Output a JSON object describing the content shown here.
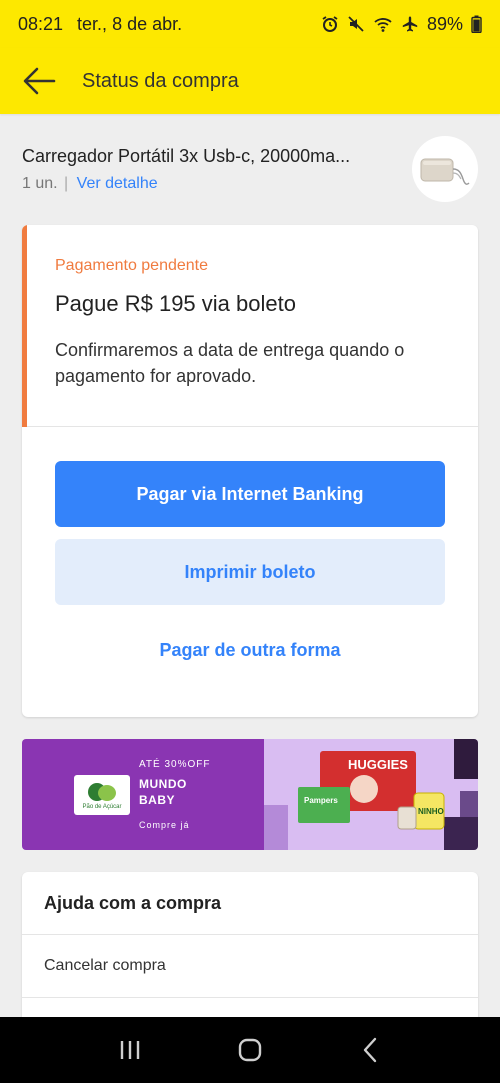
{
  "status_bar": {
    "time": "08:21",
    "date": "ter., 8 de abr.",
    "battery": "89%"
  },
  "header": {
    "title": "Status da compra"
  },
  "product": {
    "name": "Carregador Portátil 3x Usb-c, 20000ma...",
    "quantity": "1 un.",
    "separator": "|",
    "detail_link": "Ver detalhe"
  },
  "payment": {
    "status_label": "Pagamento pendente",
    "amount_text": "Pague R$ 195 via boleto",
    "message": "Confirmaremos a data de entrega quando o pagamento for aprovado.",
    "primary_button": "Pagar via Internet Banking",
    "secondary_button": "Imprimir boleto",
    "other_link": "Pagar de outra forma"
  },
  "banner": {
    "promo": "ATÉ 30%OFF",
    "title_line1": "MUNDO",
    "title_line2": "BABY",
    "cta": "Compre já",
    "logo_text": "Pão de Açúcar",
    "brand1": "HUGGIES",
    "brand2": "Pampers",
    "brand3": "NINHO"
  },
  "help": {
    "title": "Ajuda com a compra",
    "items": [
      "Cancelar compra"
    ]
  },
  "colors": {
    "header_yellow": "#fde800",
    "accent_blue": "#3483fa",
    "pending_orange": "#f07b3f",
    "banner_purple": "#8a35b2"
  }
}
